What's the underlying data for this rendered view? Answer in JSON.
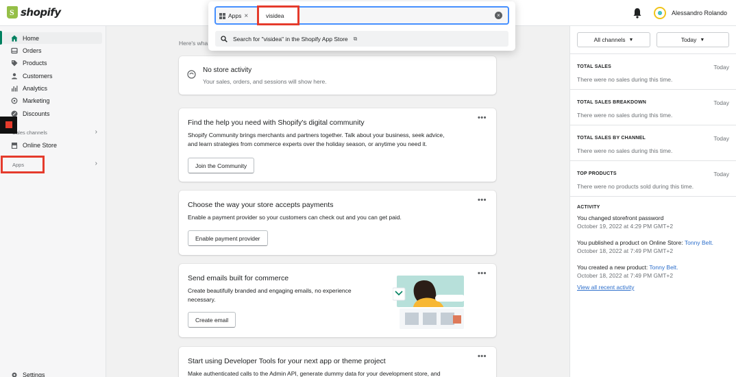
{
  "topbar": {
    "logo_text": "shopify",
    "username": "Alessandro Rolando"
  },
  "search": {
    "scope_chip": "Apps",
    "query": "visidea",
    "suggestion": "Search for \"visidea\" in the Shopify App Store"
  },
  "sidebar": {
    "items": [
      {
        "label": "Home"
      },
      {
        "label": "Orders"
      },
      {
        "label": "Products"
      },
      {
        "label": "Customers"
      },
      {
        "label": "Analytics"
      },
      {
        "label": "Marketing"
      },
      {
        "label": "Discounts"
      }
    ],
    "sales_channels_label": "Sales channels",
    "online_store": "Online Store",
    "apps_label": "Apps",
    "settings": "Settings"
  },
  "main": {
    "greeting": "Here's wha",
    "no_activity": {
      "title": "No store activity",
      "body": "Your sales, orders, and sessions will show here."
    },
    "community": {
      "title": "Find the help you need with Shopify's digital community",
      "body_1": "Shopify Community brings merchants and partners together. Talk about your business, seek advice,",
      "body_2": "and learn strategies from commerce experts over the holiday season, or anytime you need it.",
      "button": "Join the Community"
    },
    "payments": {
      "title": "Choose the way your store accepts payments",
      "body": "Enable a payment provider so your customers can check out and you can get paid.",
      "button": "Enable payment provider"
    },
    "emails": {
      "title": "Send emails built for commerce",
      "body_1": "Create beautifully branded and engaging emails, no experience",
      "body_2": "necessary.",
      "button": "Create email"
    },
    "devtools": {
      "title": "Start using Developer Tools for your next app or theme project",
      "body": "Make authenticated calls to the Admin API, generate dummy data for your development store, and"
    },
    "more_label": "•••"
  },
  "right": {
    "channels_dropdown": "All channels",
    "period_dropdown": "Today",
    "stats": [
      {
        "title": "TOTAL SALES",
        "period": "Today",
        "desc": "There were no sales during this time."
      },
      {
        "title": "TOTAL SALES BREAKDOWN",
        "period": "Today",
        "desc": "There were no sales during this time."
      },
      {
        "title": "TOTAL SALES BY CHANNEL",
        "period": "Today",
        "desc": "There were no sales during this time."
      },
      {
        "title": "TOP PRODUCTS",
        "period": "Today",
        "desc": "There were no products sold during this time."
      }
    ],
    "activity_title": "ACTIVITY",
    "activity": [
      {
        "text": "You changed storefront password",
        "link": "",
        "date": "October 19, 2022 at 4:29 PM GMT+2"
      },
      {
        "text": "You published a product on Online Store: ",
        "link": "Tonny Belt.",
        "date": "October 18, 2022 at 7:49 PM GMT+2"
      },
      {
        "text": "You created a new product: ",
        "link": "Tonny Belt.",
        "date": "October 18, 2022 at 7:49 PM GMT+2"
      }
    ],
    "view_all": "View all recent activity"
  },
  "colors": {
    "accent_green": "#008060",
    "highlight_red": "#e53b2c",
    "link_blue": "#2c6ecb",
    "focus_blue": "#458fff"
  }
}
